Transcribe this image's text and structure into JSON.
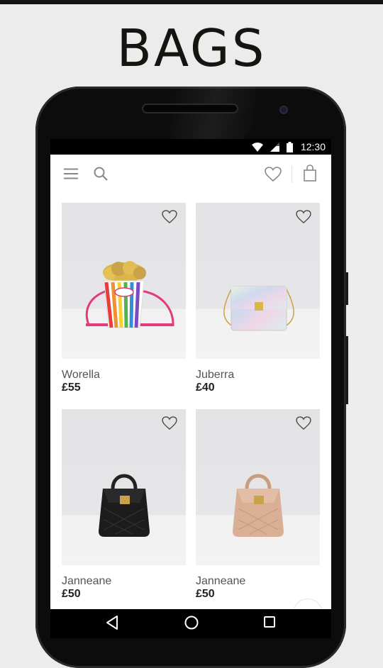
{
  "promo": {
    "title": "BAGS"
  },
  "status_bar": {
    "time": "12:30"
  },
  "app_bar": {
    "menu_icon": "hamburger-menu-icon",
    "search_icon": "search-icon",
    "wishlist_icon": "heart-outline-icon",
    "cart_icon": "shopping-bag-icon"
  },
  "products": [
    {
      "name": "Worella",
      "price": "£55",
      "image": "rainbow popcorn crossbody bag with pink strap"
    },
    {
      "name": "Juberra",
      "price": "£40",
      "image": "holographic silver chain crossbody bag"
    },
    {
      "name": "Janneane",
      "price": "£50",
      "image": "black quilted mini backpack with gold clasp"
    },
    {
      "name": "Janneane",
      "price": "£50",
      "image": "nude quilted mini backpack with gold clasp"
    }
  ],
  "nav_bar": {
    "back_icon": "back-triangle-icon",
    "home_icon": "home-circle-icon",
    "recents_icon": "recents-square-icon"
  },
  "colors": {
    "accent_pink": "#e23a7a",
    "gold": "#c9a24a",
    "page_bg": "#ececec",
    "phone_body": "#0c0c0c"
  }
}
